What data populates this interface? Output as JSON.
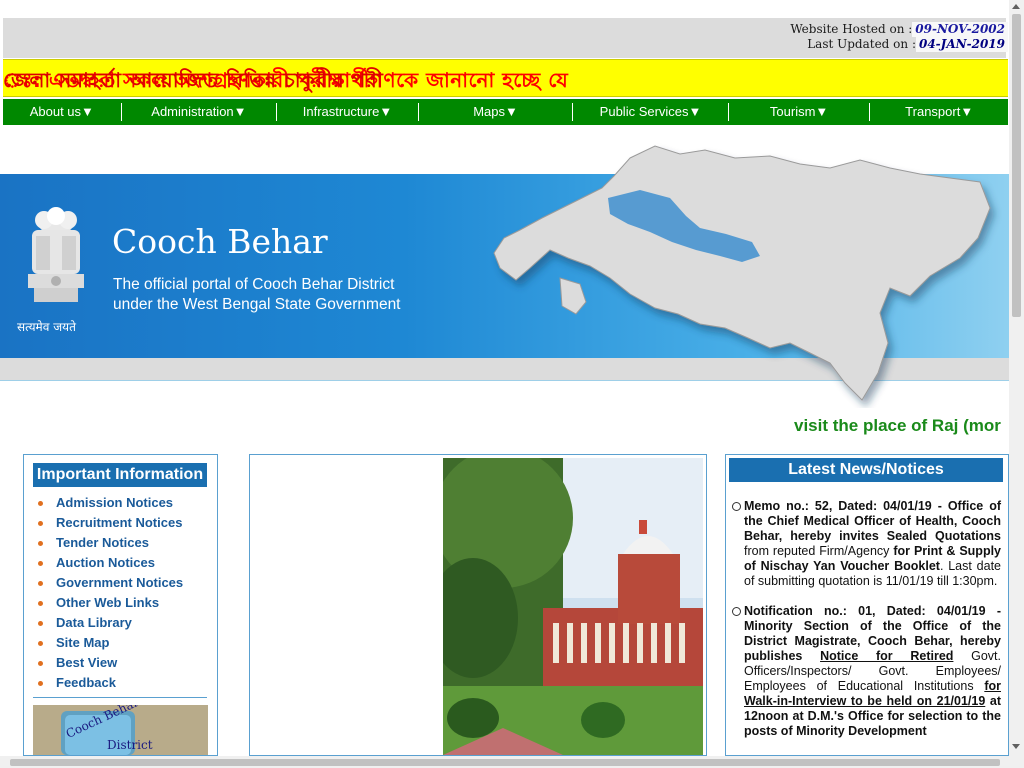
{
  "hosted": {
    "hosted_label": "Website Hosted on :",
    "hosted_date": "09-NOV-2002",
    "updated_label": "Last Updated on :",
    "updated_date": "04-JAN-2019"
  },
  "marquee": {
    "text_start": "ঃ: এতদ্বারা সকল অংশগ্রহণকারী পরীক্ষার্থীগণকে জানানো হচ্ছে যে ",
    "text_red": "জেলা সমাহর্তা আয়োজিত বিভিন্ন চাকুরীর পরী"
  },
  "nav": {
    "items": [
      {
        "label": "About us▼"
      },
      {
        "label": "Administration▼"
      },
      {
        "label": "Infrastructure▼"
      },
      {
        "label": "Maps▼"
      },
      {
        "label": "Public Services▼"
      },
      {
        "label": "Tourism▼"
      },
      {
        "label": "Transport▼"
      }
    ]
  },
  "banner": {
    "title": "Cooch Behar",
    "subtitle_line1": "The official portal of Cooch Behar District",
    "subtitle_line2": "under the West Bengal State Government",
    "emblem_text": "सत्यमेव जयते"
  },
  "visit_text": "visit the place of Raj (mor",
  "left": {
    "heading": "Important Information",
    "items": [
      {
        "label": "Admission Notices"
      },
      {
        "label": "Recruitment Notices"
      },
      {
        "label": "Tender Notices"
      },
      {
        "label": "Auction Notices"
      },
      {
        "label": "Government Notices"
      },
      {
        "label": "Other Web Links"
      },
      {
        "label": "Data Library"
      },
      {
        "label": "Site Map"
      },
      {
        "label": "Best View"
      },
      {
        "label": "Feedback"
      }
    ],
    "logo_line1": "Cooch Behar",
    "logo_line2": "District"
  },
  "news": {
    "heading": "Latest News/Notices",
    "item1_bold1": "Memo no.: 52, Dated: 04/01/19 - Office of the Chief Medical Officer of Health, Cooch Behar, hereby invites Sealed Quotations",
    "item1_normal1": " from reputed Firm/Agency ",
    "item1_bold2": "for Print & Supply of Nischay Yan Voucher Booklet",
    "item1_normal2": ". Last date of submitting quotation is 11/01/19 till 1:30pm.",
    "item2_bold1": "Notification no.: 01, Dated: 04/01/19 - Minority Section of the Office of the District Magistrate, Cooch Behar, hereby publishes ",
    "item2_link1": "Notice for Retired",
    "item2_normal1": " Govt. Officers/Inspectors/ Govt. Employees/ Employees of Educational Institutions ",
    "item2_link2": "for Walk-in-Interview to be held on 21/01/19",
    "item2_bold2": " at 12noon at D.M.'s Office for selection to the posts of Minority Development"
  },
  "colors": {
    "nav_bg": "#008800",
    "marquee_bg": "#ffff00",
    "heading_bg": "#1a6fb0",
    "link": "#1a5a99",
    "visit": "#1a8a1a"
  }
}
